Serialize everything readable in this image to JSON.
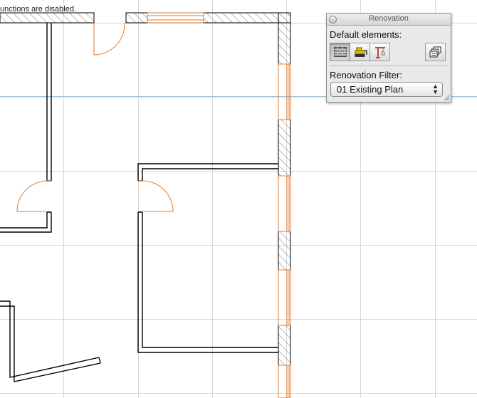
{
  "status_bar": {
    "text": "unctions are disabled."
  },
  "palette": {
    "title": "Renovation",
    "default_elements_label": "Default elements:",
    "buttons": [
      {
        "name": "existing-element",
        "icon": "brick-wall-icon",
        "selected": true
      },
      {
        "name": "to-be-demolished",
        "icon": "bulldozer-icon",
        "selected": false
      },
      {
        "name": "new-element",
        "icon": "crane-icon",
        "selected": false
      }
    ],
    "settings_icon": "layers-settings-icon",
    "renovation_filter_label": "Renovation Filter:",
    "renovation_filter_value": "01 Existing Plan"
  },
  "colors": {
    "wall": "#000000",
    "new_element": "#e07a2e",
    "grid": "#d6d6d6",
    "guide": "#9cc3de",
    "hatch": "#777777"
  }
}
